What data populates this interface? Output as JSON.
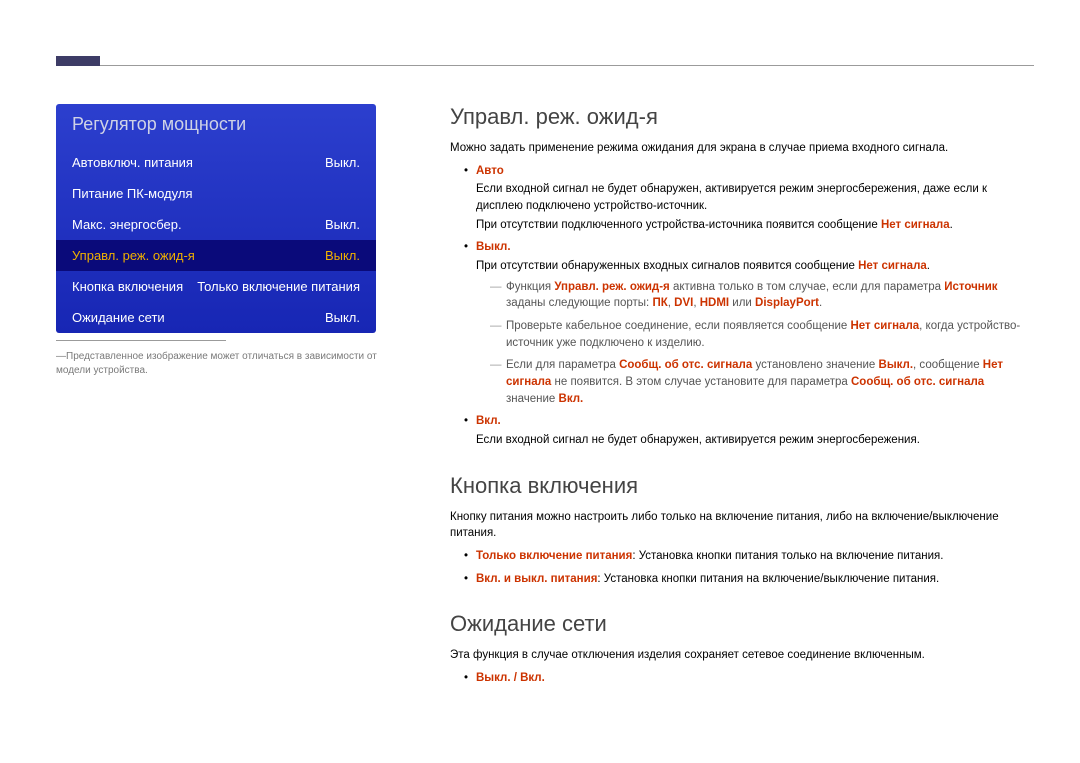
{
  "menu": {
    "title": "Регулятор мощности",
    "items": [
      {
        "label": "Автовключ. питания",
        "value": "Выкл."
      },
      {
        "label": "Питание ПК-модуля",
        "value": ""
      },
      {
        "label": "Макс. энергосбер.",
        "value": "Выкл."
      },
      {
        "label": "Управл. реж. ожид-я",
        "value": "Выкл."
      },
      {
        "label": "Кнопка включения",
        "value": "Только включение питания"
      },
      {
        "label": "Ожидание сети",
        "value": "Выкл."
      }
    ]
  },
  "note": "Представленное изображение может отличаться в зависимости от модели устройства.",
  "sections": {
    "standby": {
      "title": "Управл. реж. ожид-я",
      "intro": "Можно задать применение режима ожидания для экрана в случае приема входного сигнала.",
      "auto": {
        "head": "Авто",
        "p1": "Если входной сигнал не будет обнаружен, активируется режим энергосбережения, даже если к дисплею подключено устройство-источник.",
        "p2_a": "При отсутствии подключенного устройства-источника появится сообщение ",
        "p2_b": "Нет сигнала",
        "p2_c": "."
      },
      "off": {
        "head": "Выкл.",
        "p1_a": "При отсутствии обнаруженных входных сигналов появится сообщение ",
        "p1_b": "Нет сигнала",
        "p1_c": ".",
        "d1_a": "Функция ",
        "d1_b": "Управл. реж. ожид-я",
        "d1_c": " активна только в том случае, если для параметра ",
        "d1_d": "Источник",
        "d1_e": " заданы следующие порты: ",
        "d1_f": "ПК",
        "d1_g": ", ",
        "d1_h": "DVI",
        "d1_i": ", ",
        "d1_j": "HDMI",
        "d1_k": " или ",
        "d1_l": "DisplayPort",
        "d1_m": ".",
        "d2_a": "Проверьте кабельное соединение, если появляется сообщение ",
        "d2_b": "Нет сигнала",
        "d2_c": ", когда устройство-источник уже подключено к изделию.",
        "d3_a": "Если для параметра ",
        "d3_b": "Сообщ. об отс. сигнала",
        "d3_c": " установлено значение ",
        "d3_d": "Выкл.",
        "d3_e": ", сообщение ",
        "d3_f": "Нет сигнала",
        "d3_g": " не появится. В этом случае установите для параметра ",
        "d3_h": "Сообщ. об отс. сигнала",
        "d3_i": " значение ",
        "d3_j": "Вкл."
      },
      "on": {
        "head": "Вкл.",
        "p1": "Если входной сигнал не будет обнаружен, активируется режим энергосбережения."
      }
    },
    "powerbtn": {
      "title": "Кнопка включения",
      "intro": "Кнопку питания можно настроить либо только на включение питания, либо на включение/выключение питания.",
      "b1_head": "Только включение питания",
      "b1_tail": ": Установка кнопки питания только на включение питания.",
      "b2_head": "Вкл. и выкл. питания",
      "b2_tail": ": Установка кнопки питания на включение/выключение питания."
    },
    "netstandby": {
      "title": "Ожидание сети",
      "intro": "Эта функция в случае отключения изделия сохраняет сетевое соединение включенным.",
      "b1": "Выкл. / Вкл."
    }
  }
}
